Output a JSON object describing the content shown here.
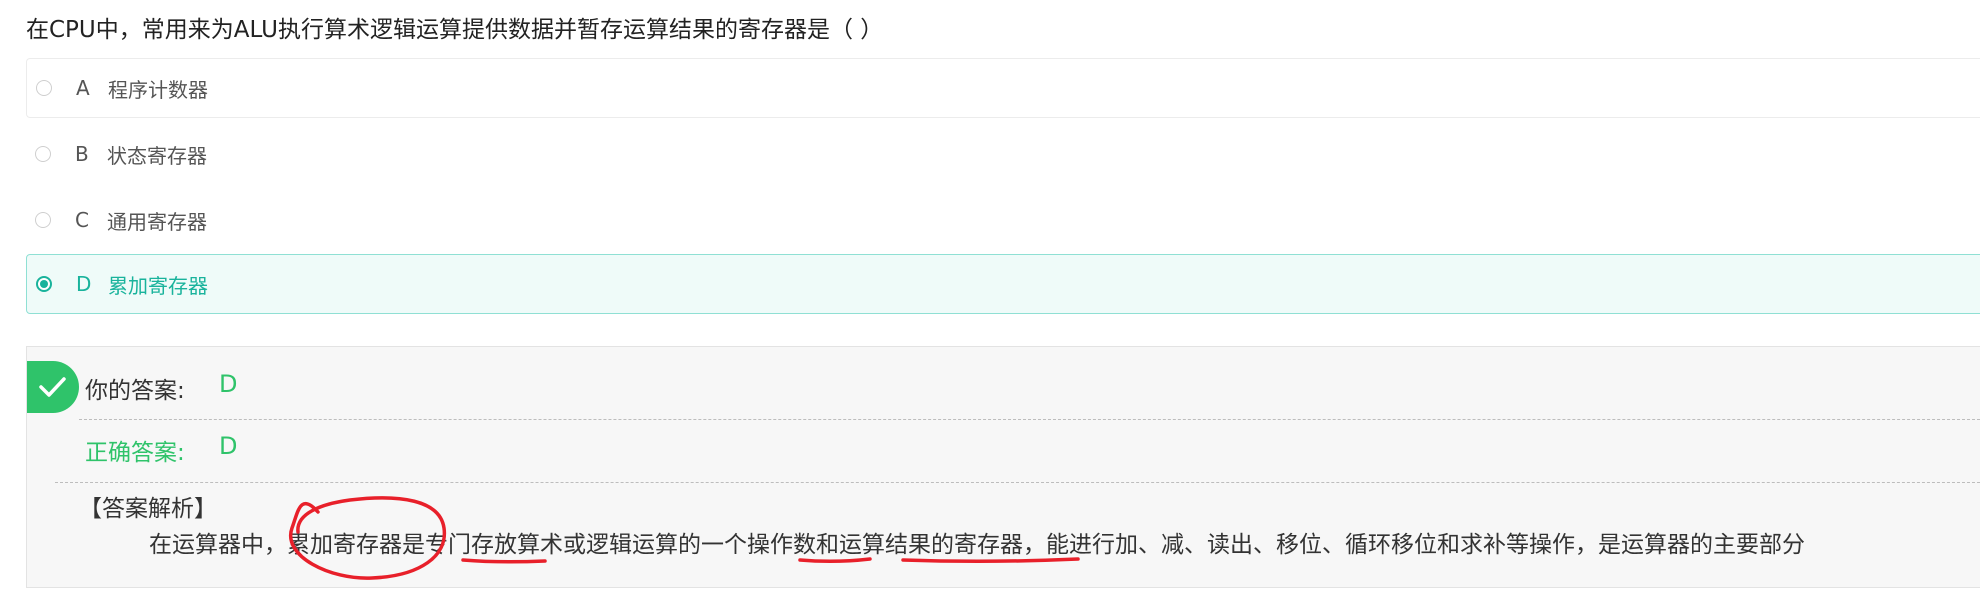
{
  "question": {
    "text": "在CPU中，常用来为ALU执行算术逻辑运算提供数据并暂存运算结果的寄存器是（ ）"
  },
  "options": [
    {
      "letter": "A",
      "text": "程序计数器"
    },
    {
      "letter": "B",
      "text": "状态寄存器"
    },
    {
      "letter": "C",
      "text": "通用寄存器"
    },
    {
      "letter": "D",
      "text": "累加寄存器"
    }
  ],
  "selected_option": "D",
  "result": {
    "status_icon": "checkmark-icon",
    "your_answer_label": "你的答案:",
    "your_answer_value": "D",
    "correct_answer_label": "正确答案:",
    "correct_answer_value": "D",
    "analysis_title": "【答案解析】",
    "analysis_text": "在运算器中，累加寄存器是专门存放算术或逻辑运算的一个操作数和运算结果的寄存器，能进行加、减、读出、移位、循环移位和求补等操作，是运算器的主要部分"
  },
  "colors": {
    "accent_teal": "#19b39c",
    "success_green": "#2fc36a",
    "annotation_red": "#e8202a"
  }
}
